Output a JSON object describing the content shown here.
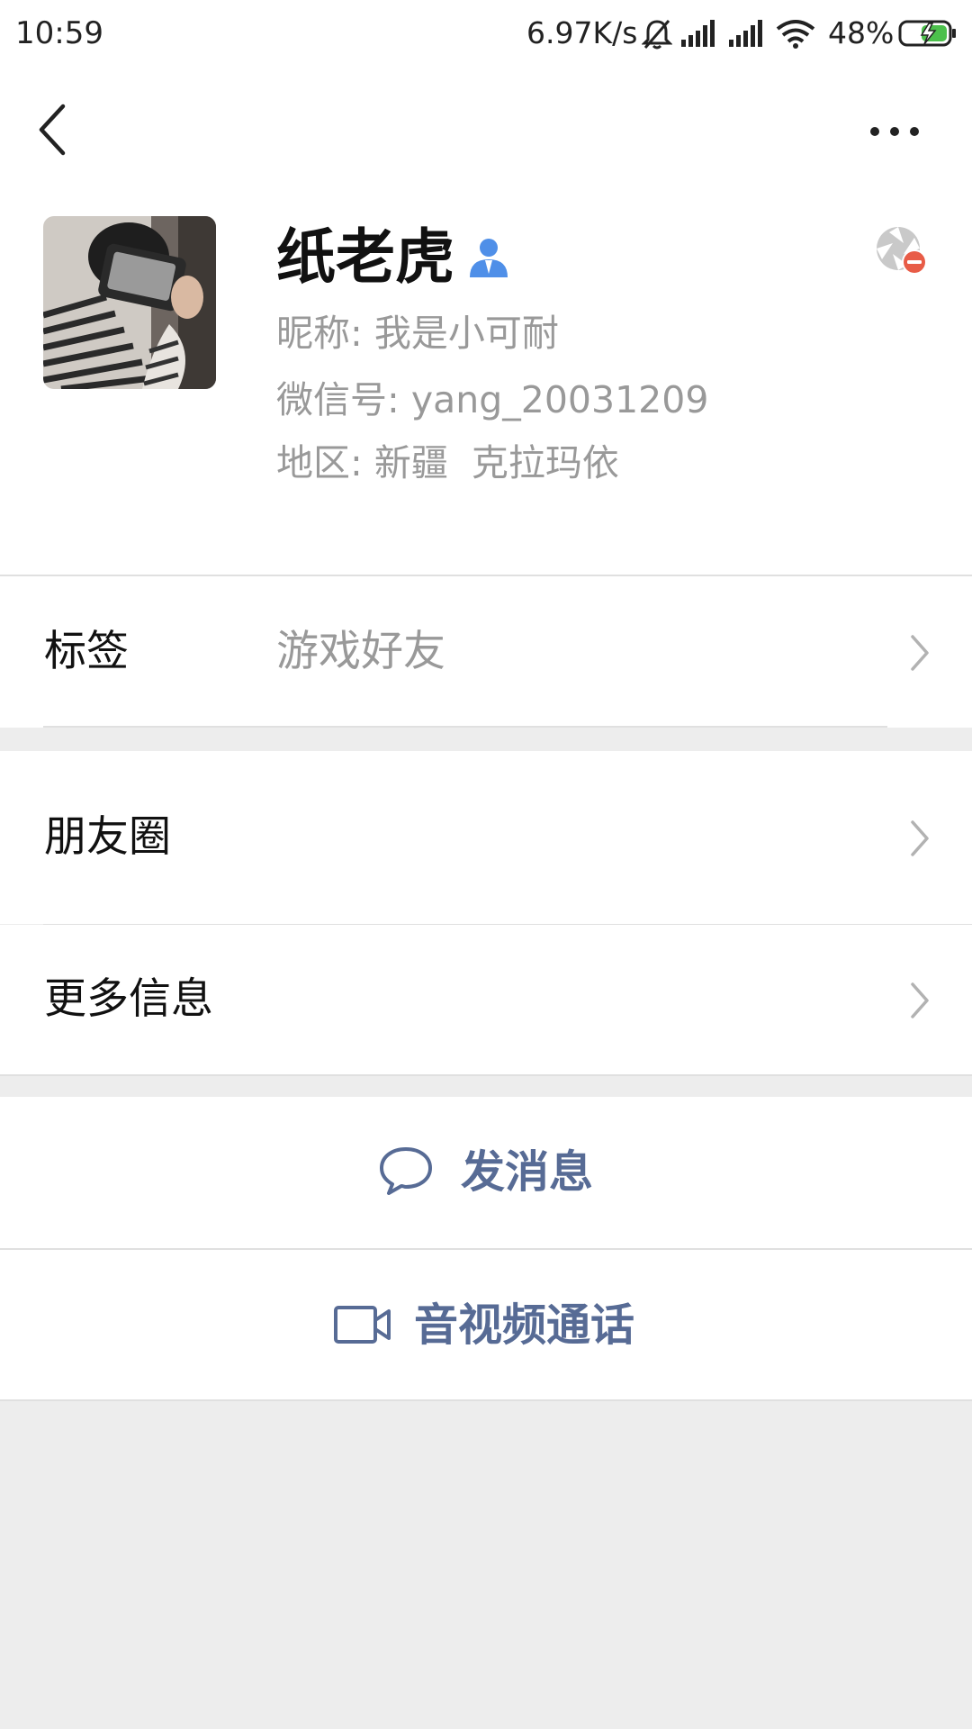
{
  "status_bar": {
    "time": "10:59",
    "net_speed": "6.97K/s",
    "battery": "48%",
    "icons": [
      "bell-muted-icon",
      "signal-icon",
      "signal-icon",
      "wifi-icon",
      "battery-charging-icon"
    ]
  },
  "header": {
    "back_icon": "back-chevron-icon",
    "more_icon": "more-dots-icon"
  },
  "profile": {
    "name": "纸老虎",
    "nickname_line": "昵称: 我是小可耐",
    "wechat_id_line": "微信号: yang_20031209",
    "region_line": "地区: 新疆  克拉玛依",
    "gender_icon": "person-icon",
    "moments_blocked_icon": "shutter-blocked-icon",
    "accent_color": "#4f8fe8"
  },
  "cells": {
    "tags": {
      "label": "标签",
      "value": "游戏好友"
    },
    "moments": {
      "label": "朋友圈"
    },
    "more_info": {
      "label": "更多信息"
    }
  },
  "actions": {
    "send_message": "发消息",
    "video_call": "音视频通话",
    "link_color": "#576b95"
  }
}
